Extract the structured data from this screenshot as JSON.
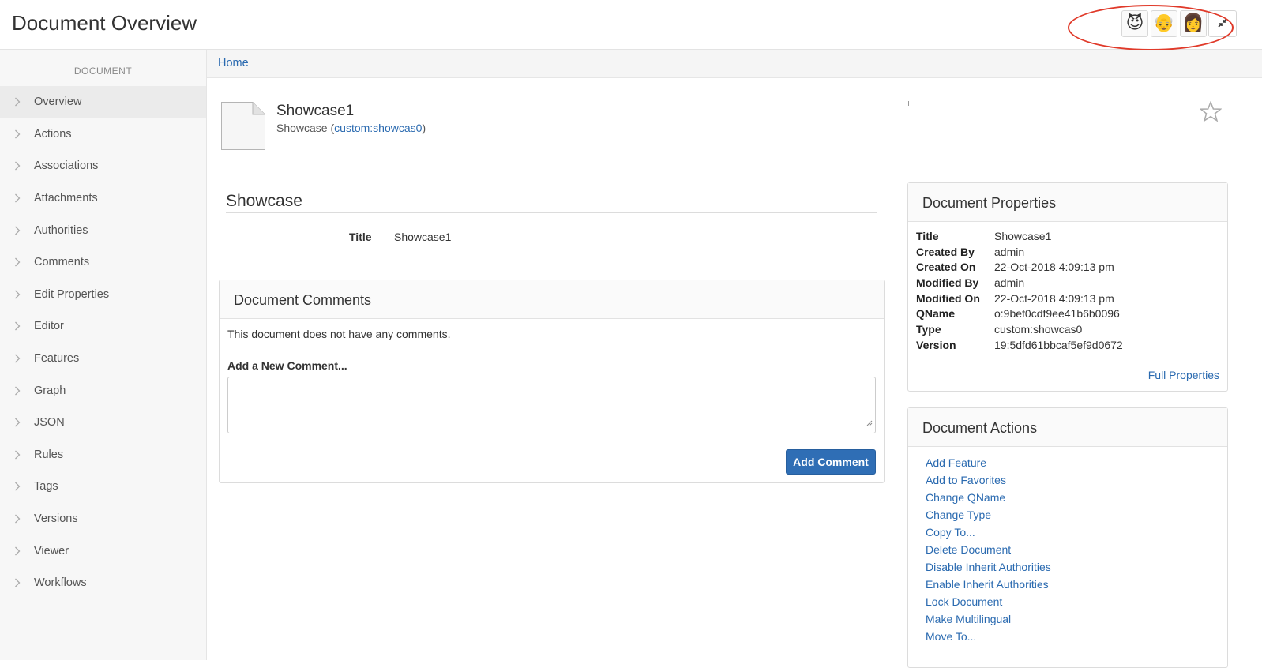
{
  "header": {
    "title": "Document Overview",
    "avatars": [
      "😈",
      "👴",
      "👩"
    ]
  },
  "sidebar": {
    "heading": "DOCUMENT",
    "items": [
      {
        "label": "Overview",
        "active": true
      },
      {
        "label": "Actions"
      },
      {
        "label": "Associations"
      },
      {
        "label": "Attachments"
      },
      {
        "label": "Authorities"
      },
      {
        "label": "Comments"
      },
      {
        "label": "Edit Properties"
      },
      {
        "label": "Editor"
      },
      {
        "label": "Features"
      },
      {
        "label": "Graph"
      },
      {
        "label": "JSON"
      },
      {
        "label": "Rules"
      },
      {
        "label": "Tags"
      },
      {
        "label": "Versions"
      },
      {
        "label": "Viewer"
      },
      {
        "label": "Workflows"
      }
    ]
  },
  "breadcrumb": {
    "home": "Home"
  },
  "document": {
    "name": "Showcase1",
    "type_label": "Showcase",
    "type_qname": "custom:showcas0"
  },
  "showcase": {
    "title": "Showcase",
    "field_label": "Title",
    "field_value": "Showcase1"
  },
  "comments": {
    "title": "Document Comments",
    "empty_text": "This document does not have any comments.",
    "new_label": "Add a New Comment...",
    "textarea_value": "",
    "button_label": "Add Comment"
  },
  "properties": {
    "title": "Document Properties",
    "rows": [
      {
        "key": "Title",
        "value": "Showcase1",
        "link": false
      },
      {
        "key": "Created By",
        "value": "admin",
        "link": true
      },
      {
        "key": "Created On",
        "value": "22-Oct-2018 4:09:13 pm",
        "link": false
      },
      {
        "key": "Modified By",
        "value": "admin",
        "link": true
      },
      {
        "key": "Modified On",
        "value": "22-Oct-2018 4:09:13 pm",
        "link": false
      },
      {
        "key": "QName",
        "value": "o:9bef0cdf9ee41b6b0096",
        "link": false
      },
      {
        "key": "Type",
        "value": "custom:showcas0",
        "link": true
      },
      {
        "key": "Version",
        "value": "19:5dfd61bbcaf5ef9d0672",
        "link": true
      }
    ],
    "full_link": "Full Properties"
  },
  "actions": {
    "title": "Document Actions",
    "items": [
      "Add Feature",
      "Add to Favorites",
      "Change QName",
      "Change Type",
      "Copy To...",
      "Delete Document",
      "Disable Inherit Authorities",
      "Enable Inherit Authorities",
      "Lock Document",
      "Make Multilingual",
      "Move To..."
    ]
  },
  "colors": {
    "link": "#2a6ab0",
    "primary_button": "#2f6eb5",
    "annotation": "#e03a2a"
  }
}
